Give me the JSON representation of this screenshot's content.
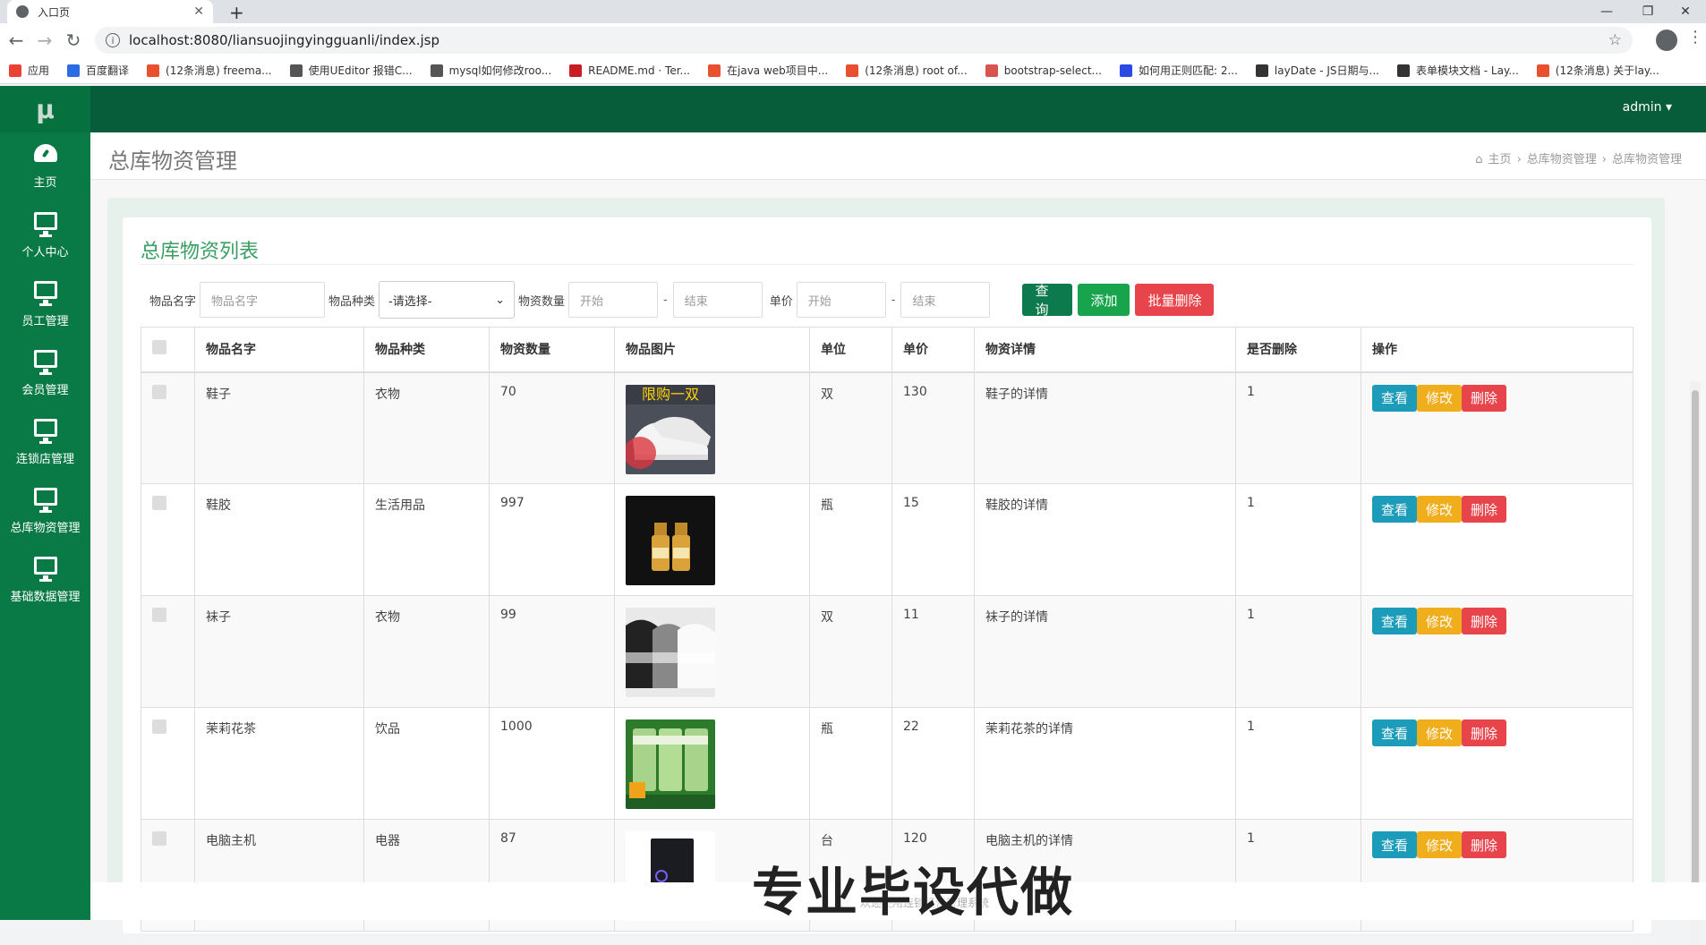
{
  "browser": {
    "tab_title": "入口页",
    "new_tab": "+",
    "url": "localhost:8080/liansuojingyingguanli/index.jsp",
    "bookmarks": [
      {
        "label": "应用",
        "color": "#ea4335"
      },
      {
        "label": "百度翻译",
        "color": "#2b6be4"
      },
      {
        "label": "(12条消息) freema...",
        "color": "#e8502f"
      },
      {
        "label": "使用UEditor 报错C...",
        "color": "#555555"
      },
      {
        "label": "mysql如何修改roo...",
        "color": "#555555"
      },
      {
        "label": "README.md · Ter...",
        "color": "#c71d23"
      },
      {
        "label": "在java web项目中...",
        "color": "#e8502f"
      },
      {
        "label": "(12条消息) root of...",
        "color": "#e8502f"
      },
      {
        "label": "bootstrap-select...",
        "color": "#d9534f"
      },
      {
        "label": "如何用正则匹配: 2...",
        "color": "#2b4ae4"
      },
      {
        "label": "layDate - JS日期与...",
        "color": "#333333"
      },
      {
        "label": "表单模块文档 - Lay...",
        "color": "#333333"
      },
      {
        "label": "(12条消息) 关于lay...",
        "color": "#e8502f"
      }
    ]
  },
  "app": {
    "brand": "μ",
    "user": "admin ▾",
    "sidebar": [
      {
        "label": "主页",
        "icon": "dashboard-icon"
      },
      {
        "label": "个人中心",
        "icon": "monitor-icon"
      },
      {
        "label": "员工管理",
        "icon": "monitor-icon"
      },
      {
        "label": "会员管理",
        "icon": "monitor-icon"
      },
      {
        "label": "连锁店管理",
        "icon": "monitor-icon"
      },
      {
        "label": "总库物资管理",
        "icon": "monitor-icon"
      },
      {
        "label": "基础数据管理",
        "icon": "monitor-icon"
      }
    ],
    "page_title": "总库物资管理",
    "breadcrumb": [
      "主页",
      "总库物资管理",
      "总库物资管理"
    ]
  },
  "panel": {
    "title": "总库物资列表",
    "filters": {
      "name_label": "物品名字",
      "name_placeholder": "物品名字",
      "type_label": "物品种类",
      "type_value": "-请选择-",
      "qty_label": "物资数量",
      "qty_start": "开始",
      "qty_end": "结束",
      "price_label": "单价",
      "price_start": "开始",
      "price_end": "结束",
      "dash": "-"
    },
    "buttons": {
      "query": "查询",
      "add": "添加",
      "batch_delete": "批量删除"
    },
    "columns": [
      "物品名字",
      "物品种类",
      "物资数量",
      "物品图片",
      "单位",
      "单价",
      "物资详情",
      "是否删除",
      "操作"
    ],
    "row_actions": {
      "view": "查看",
      "edit": "修改",
      "delete": "删除"
    },
    "rows": [
      {
        "name": "鞋子",
        "type": "衣物",
        "qty": "70",
        "unit": "双",
        "price": "130",
        "detail": "鞋子的详情",
        "deleted": "1",
        "img": "shoes",
        "img_caption": "限购一双"
      },
      {
        "name": "鞋胶",
        "type": "生活用品",
        "qty": "997",
        "unit": "瓶",
        "price": "15",
        "detail": "鞋胶的详情",
        "deleted": "1",
        "img": "glue"
      },
      {
        "name": "袜子",
        "type": "衣物",
        "qty": "99",
        "unit": "双",
        "price": "11",
        "detail": "袜子的详情",
        "deleted": "1",
        "img": "socks"
      },
      {
        "name": "茉莉花茶",
        "type": "饮品",
        "qty": "1000",
        "unit": "瓶",
        "price": "22",
        "detail": "茉莉花茶的详情",
        "deleted": "1",
        "img": "tea"
      },
      {
        "name": "电脑主机",
        "type": "电器",
        "qty": "87",
        "unit": "台",
        "price": "120",
        "detail": "电脑主机的详情",
        "deleted": "1",
        "img": "pc"
      }
    ]
  },
  "footer": {
    "text": "欢迎使用连锁经营管理系统",
    "watermark": "专业毕设代做"
  }
}
